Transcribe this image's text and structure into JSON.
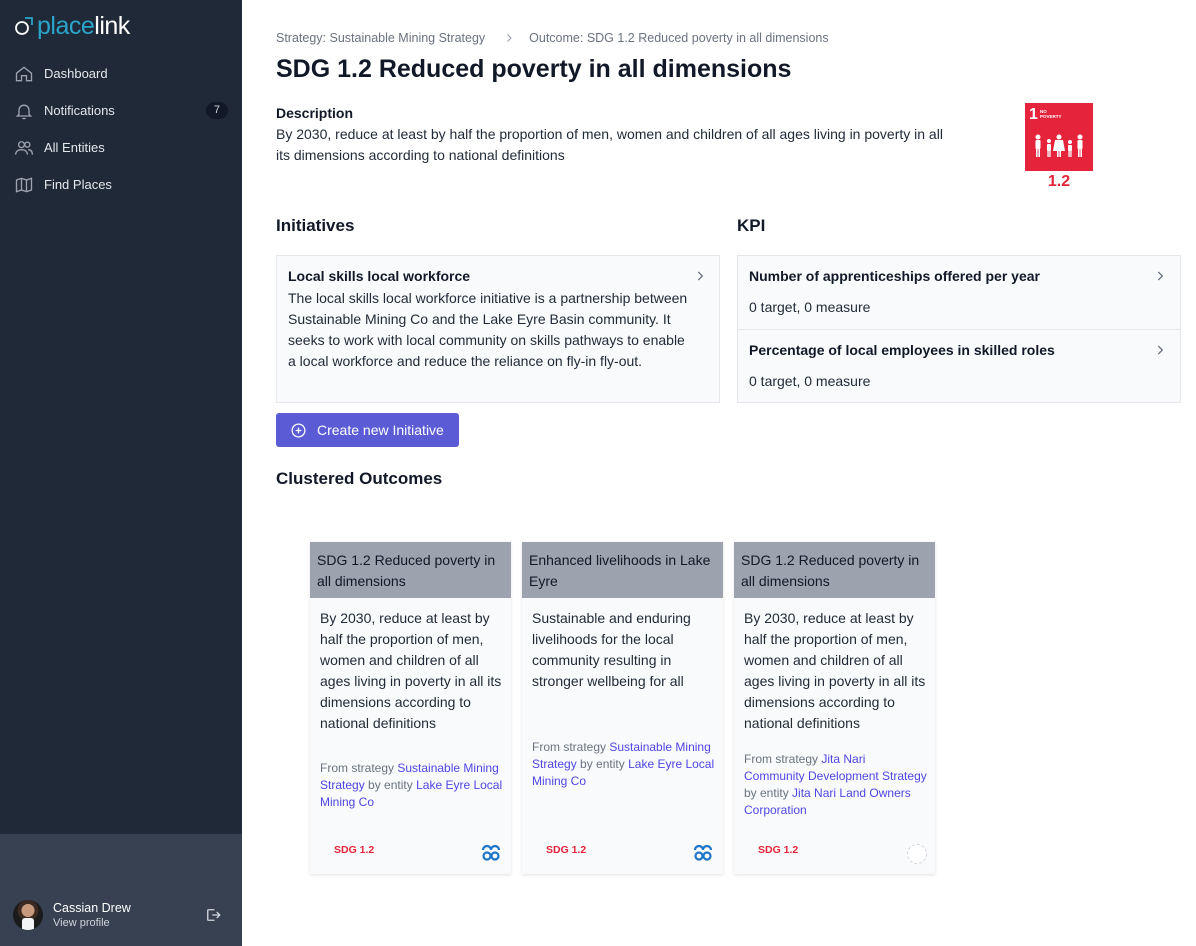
{
  "app": {
    "logo_part1": "place",
    "logo_part2": "link"
  },
  "sidebar": {
    "items": [
      {
        "label": "Dashboard",
        "icon": "home-icon"
      },
      {
        "label": "Notifications",
        "icon": "bell-icon",
        "badge": "7"
      },
      {
        "label": "All Entities",
        "icon": "users-icon"
      },
      {
        "label": "Find Places",
        "icon": "map-icon"
      }
    ],
    "user": {
      "name": "Cassian Drew",
      "link": "View profile"
    }
  },
  "breadcrumb": {
    "strategy": "Strategy: Sustainable Mining Strategy",
    "outcome": "Outcome: SDG 1.2 Reduced poverty in all dimensions"
  },
  "page": {
    "title": "SDG 1.2 Reduced poverty in all dimensions",
    "description_label": "Description",
    "description": "By 2030, reduce at least by half the proportion of men, women and children of all ages living in poverty in all its dimensions according to national definitions",
    "sdg_badge": {
      "number": "1",
      "label_line1": "NO",
      "label_line2": "POVERTY",
      "code": "1.2",
      "color": "#e5243b"
    }
  },
  "initiatives": {
    "heading": "Initiatives",
    "items": [
      {
        "title": "Local skills local workforce",
        "body": "The local skills local workforce initiative is a partnership between Sustainable Mining Co and the Lake Eyre Basin community. It seeks to work with local community on skills pathways to enable a local workforce and reduce the reliance on fly-in fly-out."
      }
    ],
    "create_button": "Create new Initiative"
  },
  "kpi": {
    "heading": "KPI",
    "items": [
      {
        "title": "Number of apprenticeships offered per year",
        "measure": "0 target, 0 measure"
      },
      {
        "title": "Percentage of local employees in skilled roles",
        "measure": "0 target, 0 measure"
      }
    ]
  },
  "clustered": {
    "heading": "Clustered Outcomes",
    "cards": [
      {
        "title": "SDG 1.2 Reduced poverty in all dimensions",
        "body": "By 2030, reduce at least by half the proportion of men, women and children of all ages living in poverty in all its dimensions according to national definitions",
        "from_prefix": "From strategy",
        "strategy": "Sustainable Mining Strategy",
        "by_prefix": "by entity",
        "entity": "Lake Eyre Local Mining Co",
        "tag": "SDG 1.2",
        "icon": "entity-logo-icon"
      },
      {
        "title": "Enhanced livelihoods in Lake Eyre",
        "body": "Sustainable and enduring livelihoods for the local community resulting in stronger wellbeing for all",
        "from_prefix": "From strategy",
        "strategy": "Sustainable Mining Strategy",
        "by_prefix": "by entity",
        "entity": "Lake Eyre Local Mining Co",
        "tag": "SDG 1.2",
        "icon": "entity-logo-icon"
      },
      {
        "title": "SDG 1.2 Reduced poverty in all dimensions",
        "body": "By 2030, reduce at least by half the proportion of men, women and children of all ages living in poverty in all its dimensions according to national definitions",
        "from_prefix": "From strategy",
        "strategy": "Jita Nari Community Development Strategy",
        "by_prefix": "by entity",
        "entity": "Jita Nari Land Owners Corporation",
        "tag": "SDG 1.2",
        "icon": "empty-avatar-icon"
      }
    ]
  },
  "colors": {
    "sidebar_bg": "#1f2937",
    "accent": "#5b5bd6",
    "sdg_red": "#e5243b",
    "link": "#4f46e5"
  }
}
